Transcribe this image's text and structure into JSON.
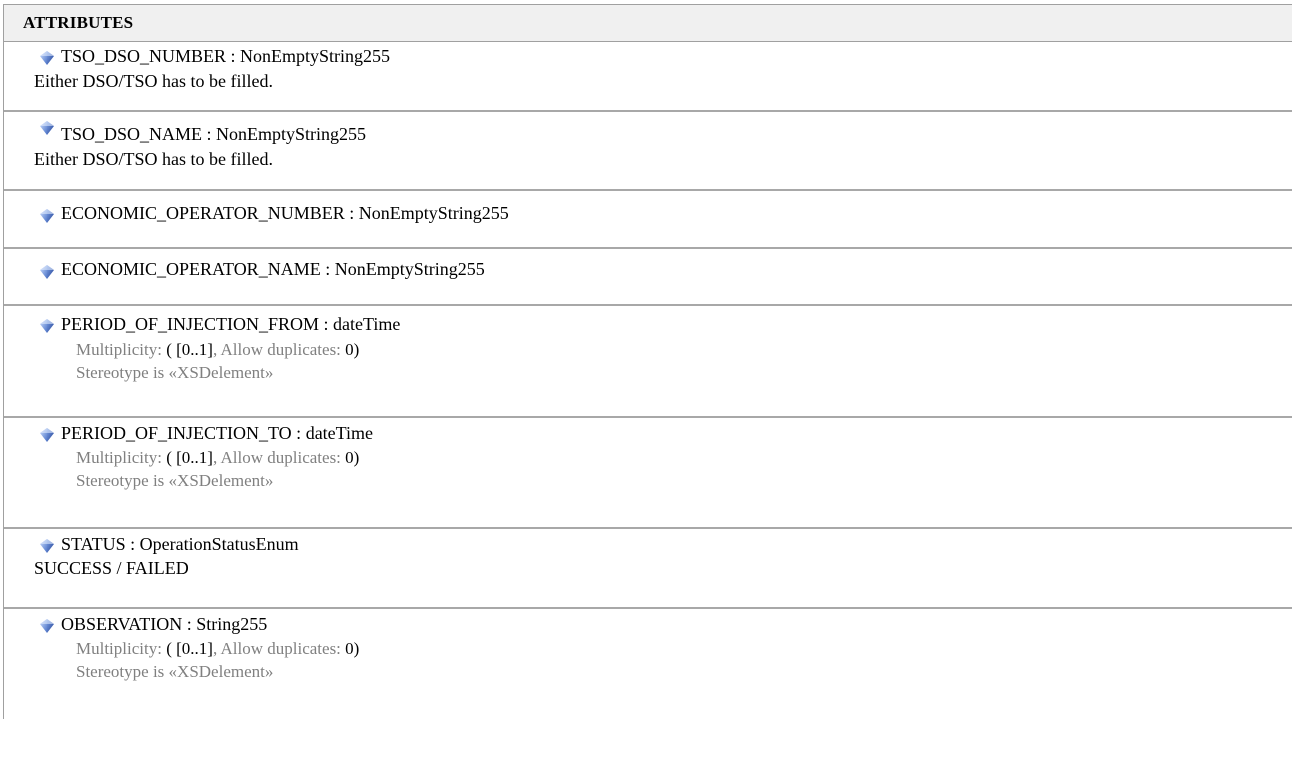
{
  "section": {
    "title": "ATTRIBUTES"
  },
  "attributes": [
    {
      "name": "TSO_DSO_NUMBER",
      "sep": " : ",
      "type": "NonEmptyString255",
      "note": "Either DSO/TSO has to be filled."
    },
    {
      "name": "TSO_DSO_NAME",
      "sep": " : ",
      "type": "NonEmptyString255",
      "note": "Either DSO/TSO has to be filled."
    },
    {
      "name": "ECONOMIC_OPERATOR_NUMBER",
      "sep": " : ",
      "type": "NonEmptyString255"
    },
    {
      "name": "ECONOMIC_OPERATOR_NAME",
      "sep": " : ",
      "type": "NonEmptyString255"
    },
    {
      "name": "PERIOD_OF_INJECTION_FROM",
      "sep": " : ",
      "type": "dateTime",
      "multiplicity_label": "Multiplicity: ",
      "multiplicity_open": "( ",
      "multiplicity_value": "[0..1]",
      "allow_dup_label": ", Allow duplicates: ",
      "allow_dup_value": "0)",
      "stereotype": "Stereotype is «XSDelement»"
    },
    {
      "name": "PERIOD_OF_INJECTION_TO",
      "sep": " : ",
      "type": "dateTime",
      "multiplicity_label": "Multiplicity: ",
      "multiplicity_open": "( ",
      "multiplicity_value": "[0..1]",
      "allow_dup_label": ", Allow duplicates: ",
      "allow_dup_value": "0)",
      "stereotype": "Stereotype is «XSDelement»"
    },
    {
      "name": "STATUS",
      "sep": " : ",
      "type": "OperationStatusEnum",
      "note": "SUCCESS / FAILED"
    },
    {
      "name": "OBSERVATION",
      "sep": " : ",
      "type": "String255",
      "multiplicity_label": "Multiplicity: ",
      "multiplicity_open": "( ",
      "multiplicity_value": "[0..1]",
      "allow_dup_label": ", Allow duplicates: ",
      "allow_dup_value": "0)",
      "stereotype": "Stereotype is «XSDelement»"
    }
  ],
  "icons": {
    "attribute": "attribute-gem-icon"
  },
  "colors": {
    "header_bg": "#f0f0f0",
    "separator": "#a8a8a8",
    "meta_text": "#808080"
  }
}
